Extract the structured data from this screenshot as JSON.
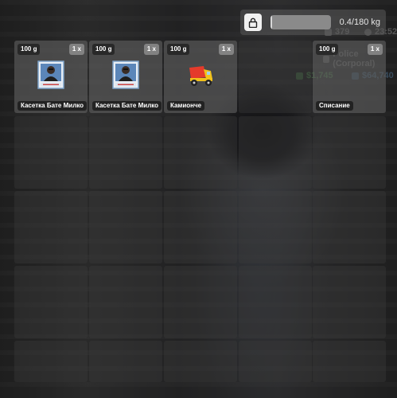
{
  "hud": {
    "level": "379",
    "time": "23:52",
    "job": "Police (Corporal)",
    "cash": "$1,745",
    "bank": "$64,740"
  },
  "inventory": {
    "weight_text": "0.4/180 kg",
    "weight_fraction": 0.0022,
    "lock_icon": "lock-icon",
    "items": [
      {
        "weight": "100 g",
        "qty": "1 x",
        "name": "Касетка Бате Милко",
        "icon": "cassette-portrait-icon"
      },
      {
        "weight": "100 g",
        "qty": "1 x",
        "name": "Касетка Бате Милко",
        "icon": "cassette-portrait-icon"
      },
      {
        "weight": "100 g",
        "qty": "1 x",
        "name": "Камионче",
        "icon": "toy-truck-icon"
      },
      {
        "weight": "100 g",
        "qty": "1 x",
        "name": "Списание",
        "icon": "magazine-icon"
      }
    ]
  }
}
